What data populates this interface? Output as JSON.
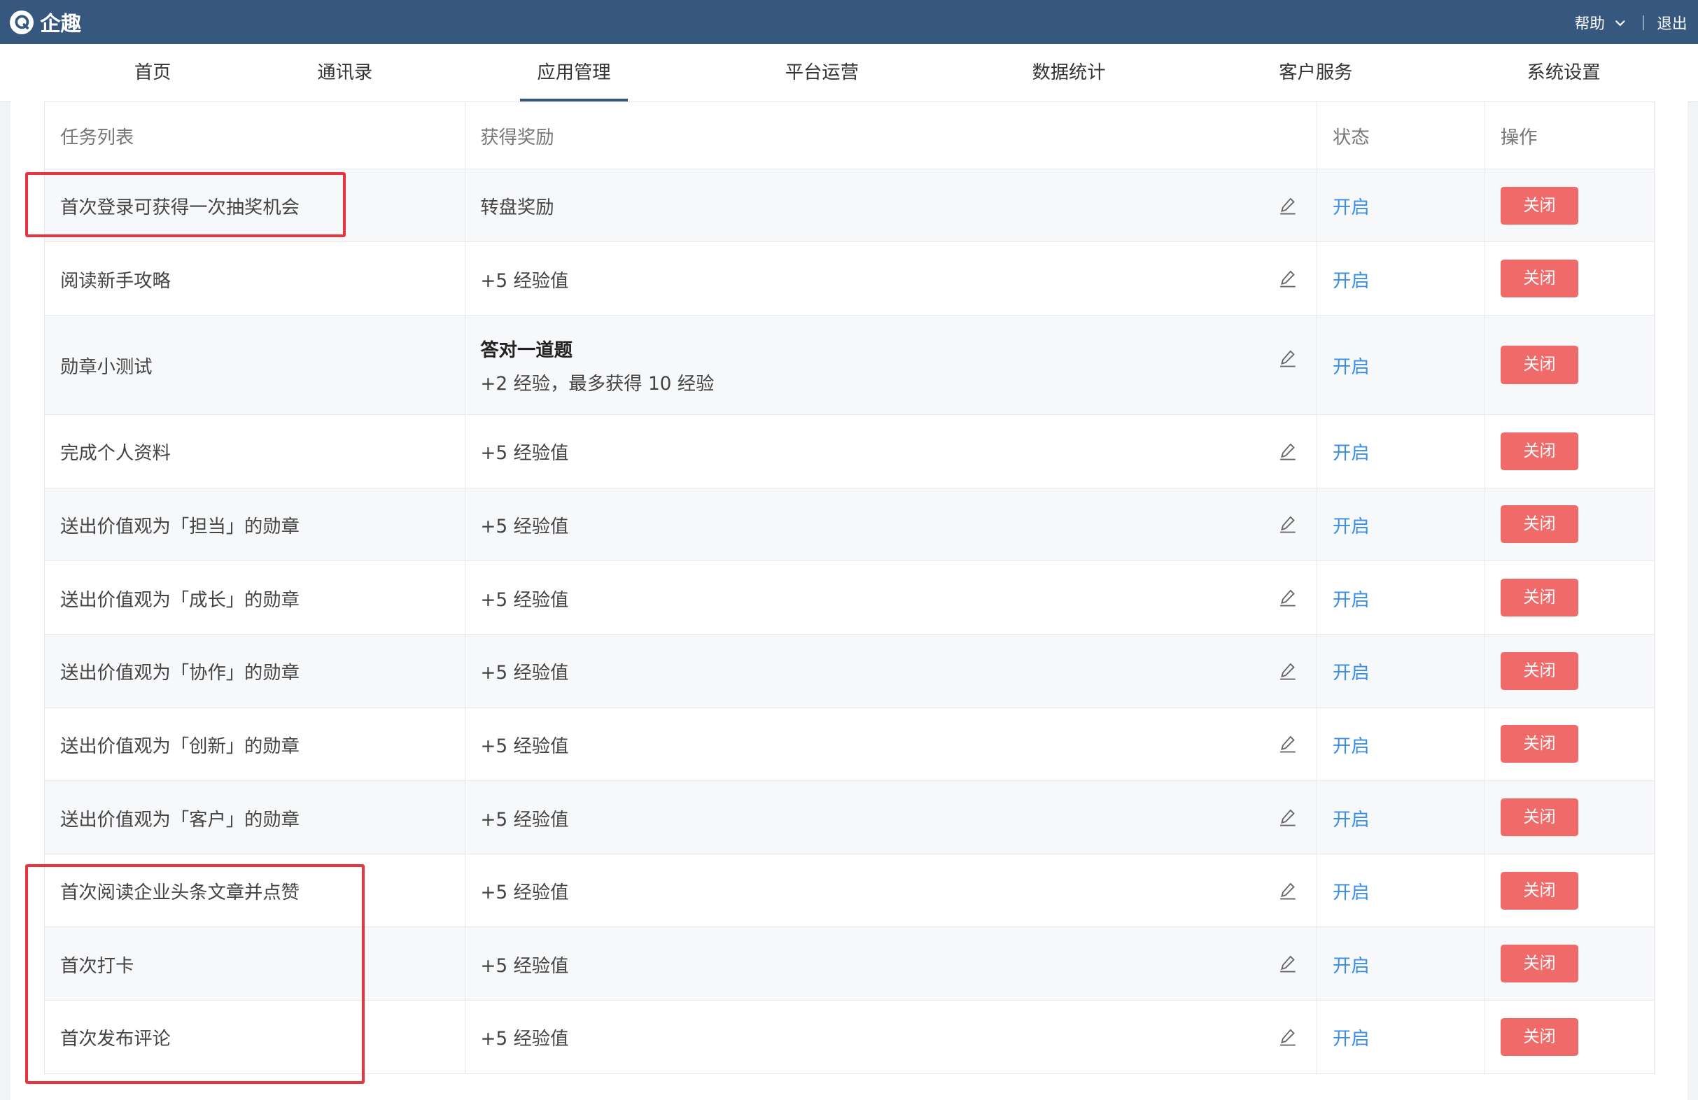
{
  "app": {
    "name": "企趣"
  },
  "header": {
    "help_label": "帮助",
    "logout_label": "退出"
  },
  "nav": {
    "tabs": [
      {
        "label": "首页"
      },
      {
        "label": "通讯录"
      },
      {
        "label": "应用管理"
      },
      {
        "label": "平台运营"
      },
      {
        "label": "数据统计"
      },
      {
        "label": "客户服务"
      },
      {
        "label": "系统设置"
      }
    ],
    "active": "应用管理"
  },
  "table": {
    "columns": {
      "task": "任务列表",
      "reward": "获得奖励",
      "status": "状态",
      "action": "操作"
    },
    "rows": [
      {
        "task": "首次登录可获得一次抽奖机会",
        "reward": "转盘奖励",
        "status": "开启",
        "action": "关闭"
      },
      {
        "task": "阅读新手攻略",
        "reward": "+5 经验值",
        "status": "开启",
        "action": "关闭"
      },
      {
        "task": "勋章小测试",
        "reward_title": "答对一道题",
        "reward": "+2 经验，最多获得 10 经验",
        "status": "开启",
        "action": "关闭"
      },
      {
        "task": "完成个人资料",
        "reward": "+5 经验值",
        "status": "开启",
        "action": "关闭"
      },
      {
        "task": "送出价值观为「担当」的勋章",
        "reward": "+5 经验值",
        "status": "开启",
        "action": "关闭"
      },
      {
        "task": "送出价值观为「成长」的勋章",
        "reward": "+5 经验值",
        "status": "开启",
        "action": "关闭"
      },
      {
        "task": "送出价值观为「协作」的勋章",
        "reward": "+5 经验值",
        "status": "开启",
        "action": "关闭"
      },
      {
        "task": "送出价值观为「创新」的勋章",
        "reward": "+5 经验值",
        "status": "开启",
        "action": "关闭"
      },
      {
        "task": "送出价值观为「客户」的勋章",
        "reward": "+5 经验值",
        "status": "开启",
        "action": "关闭"
      },
      {
        "task": "首次阅读企业头条文章并点赞",
        "reward": "+5 经验值",
        "status": "开启",
        "action": "关闭"
      },
      {
        "task": "首次打卡",
        "reward": "+5 经验值",
        "status": "开启",
        "action": "关闭"
      },
      {
        "task": "首次发布评论",
        "reward": "+5 经验值",
        "status": "开启",
        "action": "关闭"
      }
    ]
  },
  "colors": {
    "header_bg": "#36587f",
    "link": "#3a8ee6",
    "danger": "#f16a6a",
    "highlight": "#e8343f"
  },
  "icons": {
    "logo": "logo-icon",
    "dropdown": "chevron-down-icon",
    "edit": "pencil-icon"
  }
}
